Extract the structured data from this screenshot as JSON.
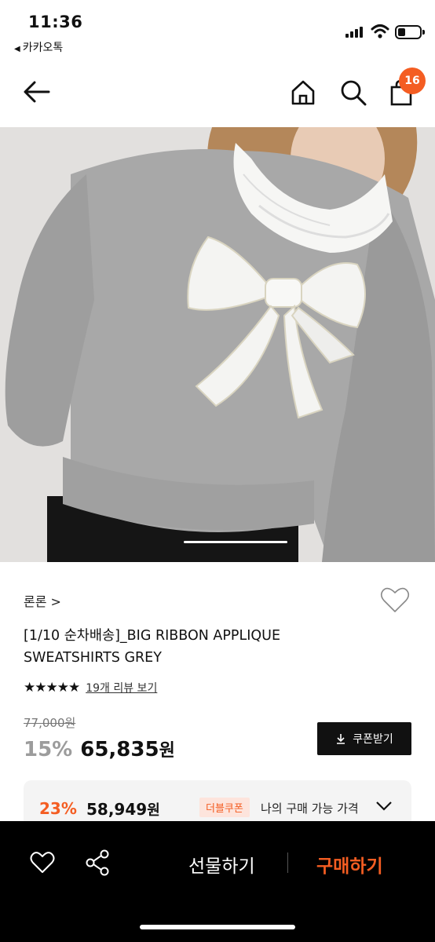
{
  "status_bar": {
    "time": "11:36",
    "back_app": "카카오톡"
  },
  "nav": {
    "cart_count": "16",
    "icons": [
      "back-arrow-icon",
      "home-icon",
      "search-icon",
      "cart-icon"
    ]
  },
  "hero": {
    "alt": "grey sweatshirt with white ribbon applique"
  },
  "product": {
    "brand": "론론 >",
    "title": "[1/10 순차배송]_BIG RIBBON APPLIQUE SWEATSHIRTS GREY",
    "stars": "★★★★★",
    "reviews": "19개 리뷰 보기",
    "original_price": "77,000원",
    "discount": "15%",
    "price": "65,835",
    "won": "원",
    "coupon_button": "쿠폰받기"
  },
  "best_price": {
    "discount": "23%",
    "price": "58,949",
    "won": "원",
    "coupon_tag": "더블쿠폰",
    "label": "나의 구매 가능 가격"
  },
  "bottom_bar": {
    "gift": "선물하기",
    "buy": "구매하기"
  },
  "colors": {
    "accent": "#f45d22",
    "bar": "#000000"
  }
}
